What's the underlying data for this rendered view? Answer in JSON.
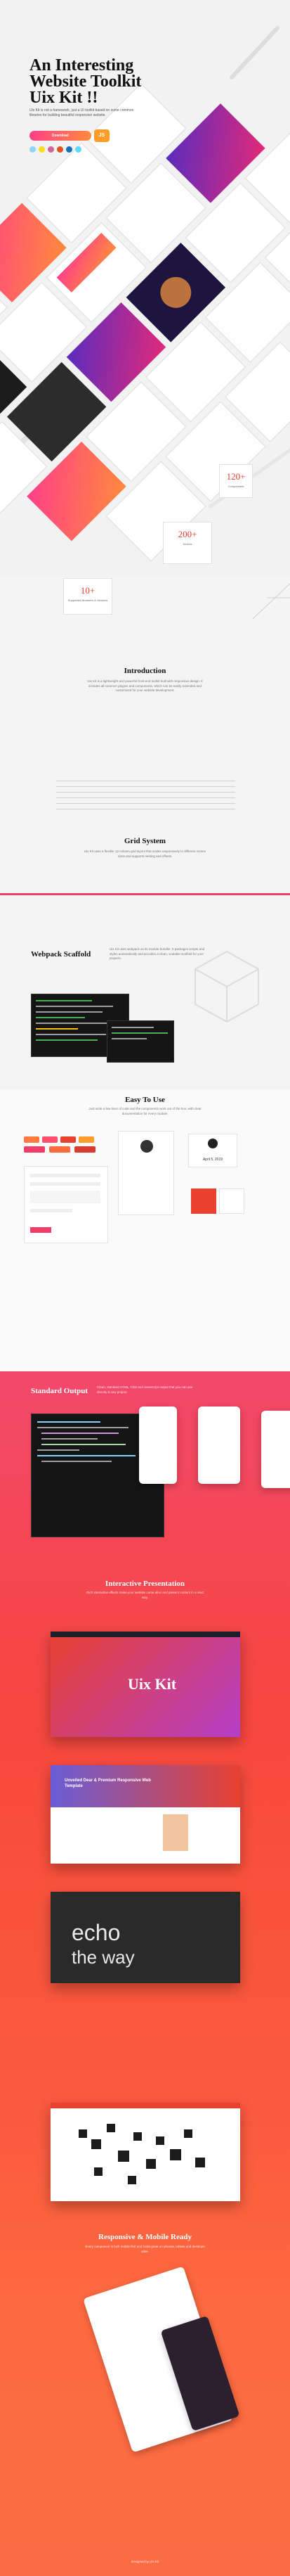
{
  "hero": {
    "title": "An Interesting Website Toolkit Uix Kit !!",
    "subtitle": "Uix Kit is not a framework, just a UI toolkit based on some common libraries for building beautiful responsive website.",
    "download_label": "Download",
    "version_badge": "JS",
    "colors": {
      "accent_start": "#ff3f88",
      "accent_end": "#ff8a3d",
      "badge": "#ff9c2a"
    },
    "tech_icons": [
      "webpack-icon",
      "js-icon",
      "sass-icon",
      "html5-icon",
      "css3-icon",
      "react-icon"
    ],
    "stats": [
      {
        "num": "120+",
        "label": "Components"
      },
      {
        "num": "200+",
        "label": "Demos"
      },
      {
        "num": "10+",
        "label": "Supported Browsers & Versions"
      }
    ]
  },
  "intro": {
    "heading": "Introduction",
    "body": "Uix Kit is a lightweight and powerful front-end toolkit built with responsive design. It includes all common plugins and components, which can be easily extended and customized for your website development.",
    "grid_heading": "Grid System",
    "grid_body": "Uix Kit uses a flexible 12-column grid layout that scales responsively to different screen sizes and supports nesting and offsets."
  },
  "webpack": {
    "heading": "Webpack Scaffold",
    "body": "Uix Kit uses webpack as its module bundler. It packages scripts and styles automatically and provides a clean, scalable scaffold for your projects."
  },
  "easy": {
    "heading": "Easy To Use",
    "body": "Just write a few lines of code and the components work out of the box, with clear documentation for every module.",
    "date_card": "April 5, 2019"
  },
  "standard": {
    "heading": "Standard Output",
    "body": "Clean, standard HTML, CSS and JavaScript output that you can use directly in any project."
  },
  "interactive": {
    "heading": "Interactive Presentation",
    "body": "Rich interactive effects make your website come alive and present content in a vivid way.",
    "slide_title": "Uix Kit",
    "slide2_title": "Unveiled Dear & Premium Responsive Web Template"
  },
  "echo": {
    "line1": "echo",
    "line2": "the way"
  },
  "responsive": {
    "heading": "Responsive & Mobile Ready",
    "body": "Every component is built mobile first and looks great on phones, tablets and desktops alike."
  },
  "footer": {
    "credit": "Designed by Uix Kit"
  }
}
